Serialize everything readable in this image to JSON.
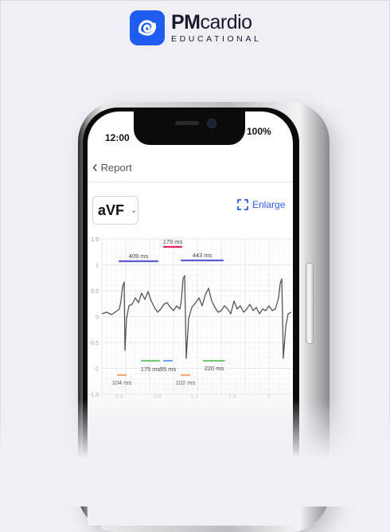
{
  "brand": {
    "name_bold": "PM",
    "name_light": "cardio",
    "subtitle": "EDUCATIONAL",
    "color": "#1f5cf0"
  },
  "status_bar": {
    "time": "12:00",
    "battery": "100%"
  },
  "nav": {
    "back_label": "Report",
    "back_icon": "chevron-left-icon"
  },
  "controls": {
    "lead_value": "aVF",
    "lead_caret_icon": "chevron-down-icon",
    "enlarge_label": "Enlarge",
    "enlarge_icon": "expand-corners-icon",
    "accent": "#2f5de0"
  },
  "chart_data": {
    "type": "line",
    "y_ticks": [
      "1.5",
      "1",
      "0.5",
      "0",
      "-0.5",
      "-1",
      "-1.5"
    ],
    "x_ticks": [
      "0.4",
      "0.8",
      "1.2",
      "1.6",
      "2"
    ],
    "grid": true,
    "intervals": [
      {
        "label": "179 ms",
        "color": "#e0245e"
      },
      {
        "label": "409 ms",
        "color": "#5b5bd6"
      },
      {
        "label": "443 ms",
        "color": "#5b5bd6"
      },
      {
        "label": "175 ms",
        "color": "#7ac97a"
      },
      {
        "label": "95 ms",
        "color": "#6aa6e8"
      },
      {
        "label": "220 ms",
        "color": "#7ac97a"
      },
      {
        "label": "104 ms",
        "color": "#f0a46a"
      },
      {
        "label": "102 ms",
        "color": "#f0a46a"
      }
    ]
  }
}
